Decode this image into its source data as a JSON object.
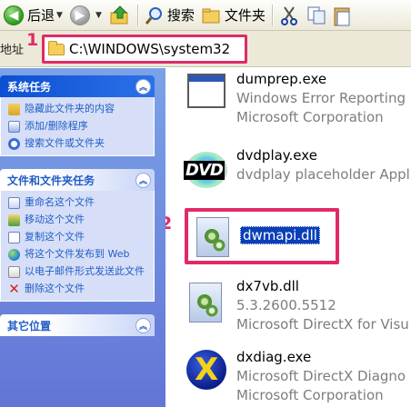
{
  "toolbar": {
    "back_label": "后退",
    "search_label": "搜索",
    "folders_label": "文件夹"
  },
  "address": {
    "label": "地址",
    "path": "C:\\WINDOWS\\system32"
  },
  "steps": {
    "step1": "1",
    "step2": "2"
  },
  "taskpane": {
    "system_tasks": {
      "title": "系统任务",
      "items": [
        "隐藏此文件夹的内容",
        "添加/删除程序",
        "搜索文件或文件夹"
      ]
    },
    "file_tasks": {
      "title": "文件和文件夹任务",
      "items": [
        "重命名这个文件",
        "移动这个文件",
        "复制这个文件",
        "将这个文件发布到 Web",
        "以电子邮件形式发送此文件",
        "删除这个文件"
      ]
    },
    "other_places": {
      "title": "其它位置"
    }
  },
  "files": [
    {
      "name": "dumprep.exe",
      "desc1": "Windows Error Reporting",
      "desc2": "Microsoft Corporation",
      "icon": "window-icon"
    },
    {
      "name": "dvdplay.exe",
      "desc1": "dvdplay placeholder Appl",
      "desc2": "",
      "icon": "dvd-icon"
    },
    {
      "name": "dwmapi.dll",
      "desc1": "",
      "desc2": "",
      "icon": "dll-icon",
      "selected": true
    },
    {
      "name": "dx7vb.dll",
      "desc1": "5.3.2600.5512",
      "desc2": "Microsoft DirectX for Visu",
      "icon": "dll-icon"
    },
    {
      "name": "dxdiag.exe",
      "desc1": "Microsoft DirectX Diagno",
      "desc2": "Microsoft Corporation",
      "icon": "directx-icon"
    }
  ],
  "icons": {
    "dvd_text": "DVD",
    "directx_text": "X"
  }
}
